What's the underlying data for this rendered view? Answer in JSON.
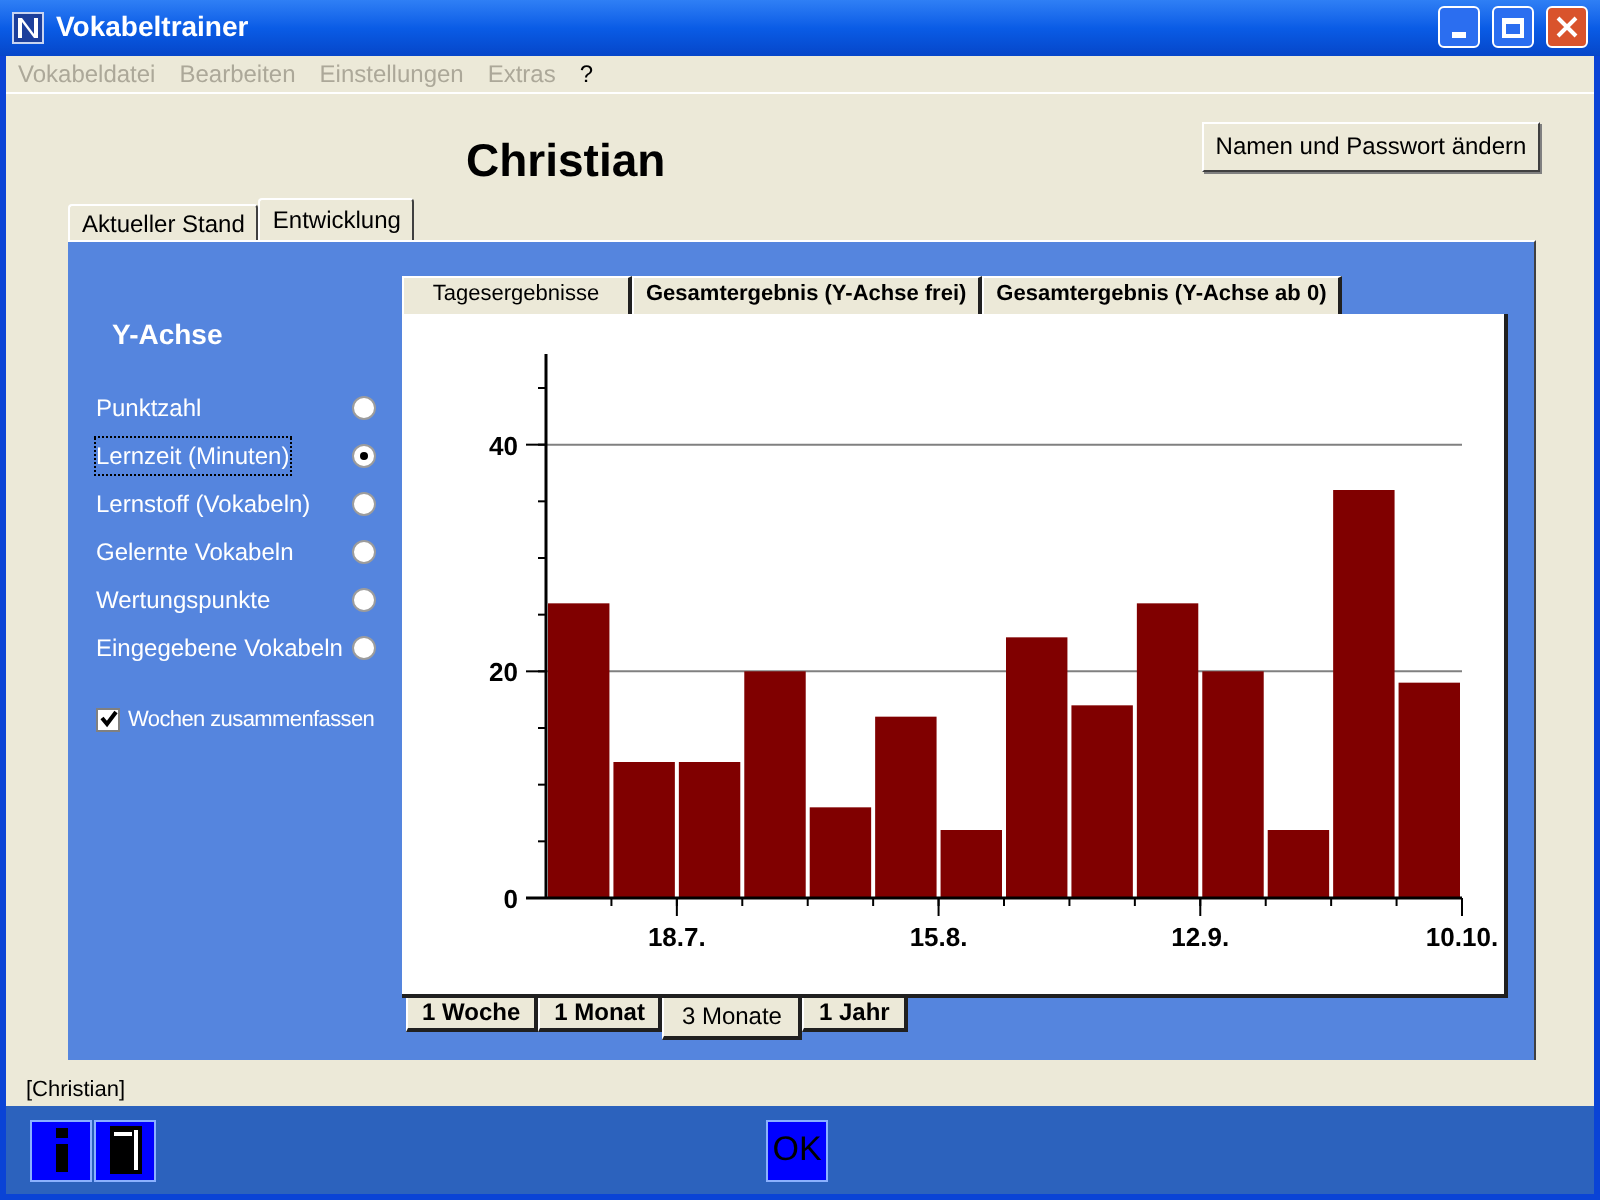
{
  "window": {
    "title": "Vokabeltrainer"
  },
  "menu": [
    {
      "label": "Vokabeldatei",
      "disabled": true
    },
    {
      "label": "Bearbeiten",
      "disabled": true
    },
    {
      "label": "Einstellungen",
      "disabled": true
    },
    {
      "label": "Extras",
      "disabled": true
    },
    {
      "label": "?",
      "disabled": false
    }
  ],
  "user_name": "Christian",
  "change_button": "Namen und Passwort ändern",
  "main_tabs": [
    {
      "label": "Aktueller Stand",
      "selected": false
    },
    {
      "label": "Entwicklung",
      "selected": true
    }
  ],
  "y_axis_panel": {
    "title": "Y-Achse",
    "options": [
      {
        "label": "Punktzahl",
        "selected": false
      },
      {
        "label": "Lernzeit (Minuten)",
        "selected": true
      },
      {
        "label": "Lernstoff (Vokabeln)",
        "selected": false
      },
      {
        "label": "Gelernte Vokabeln",
        "selected": false
      },
      {
        "label": "Wertungspunkte",
        "selected": false
      },
      {
        "label": "Eingegebene Vokabeln",
        "selected": false
      }
    ],
    "checkbox": {
      "label": "Wochen zusammenfassen",
      "checked": true
    }
  },
  "chart_tabs": [
    {
      "label": "Tagesergebnisse",
      "selected": true
    },
    {
      "label": "Gesamtergebnis (Y-Achse frei)",
      "selected": false
    },
    {
      "label": "Gesamtergebnis (Y-Achse ab 0)",
      "selected": false
    }
  ],
  "chart_data": {
    "type": "bar",
    "categories": [
      null,
      "18.7.",
      null,
      null,
      null,
      "15.8.",
      null,
      null,
      null,
      "12.9.",
      null,
      null,
      null,
      "10.10."
    ],
    "series": [
      {
        "color": "#800000",
        "values": [
          26,
          12,
          12,
          20,
          8,
          16,
          6,
          23,
          17,
          26,
          20,
          6,
          36,
          19
        ]
      }
    ],
    "ylim": [
      0,
      48
    ],
    "yticks": [
      0,
      20,
      40
    ]
  },
  "range_tabs": [
    {
      "label": "1 Woche",
      "selected": false
    },
    {
      "label": "1 Monat",
      "selected": false
    },
    {
      "label": "3 Monate",
      "selected": true
    },
    {
      "label": "1 Jahr",
      "selected": false
    }
  ],
  "status_text": "[Christian]",
  "ok_button": "OK"
}
